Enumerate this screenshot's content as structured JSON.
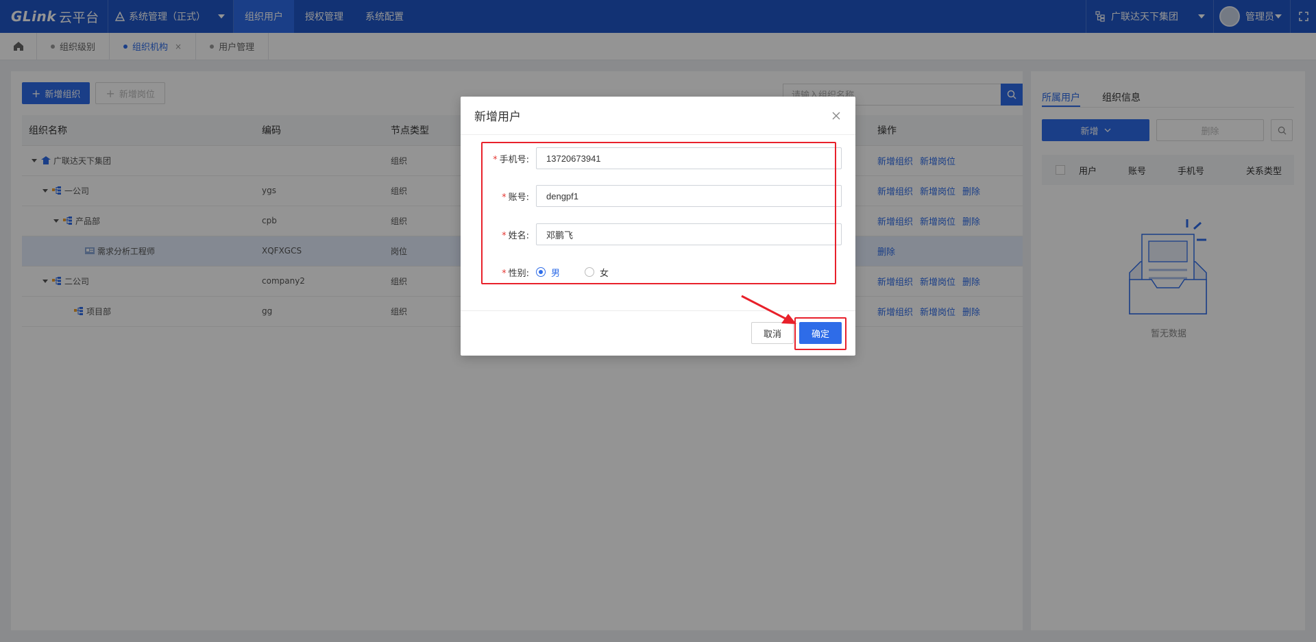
{
  "topbar": {
    "logo_main": "GLink",
    "logo_sub": "云平台",
    "system_menu": "系统管理（正式）",
    "nav": [
      "组织用户",
      "授权管理",
      "系统配置"
    ],
    "org_selector": "广联达天下集团",
    "user_name": "管理员"
  },
  "tabs": [
    {
      "label": "组织级别"
    },
    {
      "label": "组织机构",
      "closable": "×"
    },
    {
      "label": "用户管理"
    }
  ],
  "left": {
    "add_org": "新增组织",
    "add_post": "新增岗位",
    "search_placeholder": "请输入组织名称",
    "columns": [
      "组织名称",
      "编码",
      "节点类型",
      "操作"
    ],
    "rows": [
      {
        "name": "广联达天下集团",
        "code": "",
        "type": "组织",
        "ops": [
          "新增组织",
          "新增岗位"
        ]
      },
      {
        "name": "一公司",
        "code": "ygs",
        "type": "组织",
        "ops": [
          "新增组织",
          "新增岗位",
          "删除"
        ]
      },
      {
        "name": "产品部",
        "code": "cpb",
        "type": "组织",
        "ops": [
          "新增组织",
          "新增岗位",
          "删除"
        ]
      },
      {
        "name": "需求分析工程师",
        "code": "XQFXGCS",
        "type": "岗位",
        "ops": [
          "删除"
        ]
      },
      {
        "name": "二公司",
        "code": "company2",
        "type": "组织",
        "ops": [
          "新增组织",
          "新增岗位",
          "删除"
        ]
      },
      {
        "name": "项目部",
        "code": "gg",
        "type": "组织",
        "ops": [
          "新增组织",
          "新增岗位",
          "删除"
        ]
      }
    ]
  },
  "right": {
    "tabs": [
      "所属用户",
      "组织信息"
    ],
    "add": "新增",
    "delete": "删除",
    "columns": [
      "用户",
      "账号",
      "手机号",
      "关系类型"
    ],
    "empty": "暂无数据"
  },
  "modal": {
    "title": "新增用户",
    "phone_label": "手机号:",
    "phone_value": "13720673941",
    "account_label": "账号:",
    "account_value": "dengpf1",
    "name_label": "姓名:",
    "name_value": "邓鹏飞",
    "gender_label": "性别:",
    "gender_male": "男",
    "gender_female": "女",
    "cancel": "取消",
    "ok": "确定"
  },
  "colors": {
    "primary": "#2e6ce8",
    "nav": "#1f57c8",
    "annotation": "#e8202a"
  }
}
